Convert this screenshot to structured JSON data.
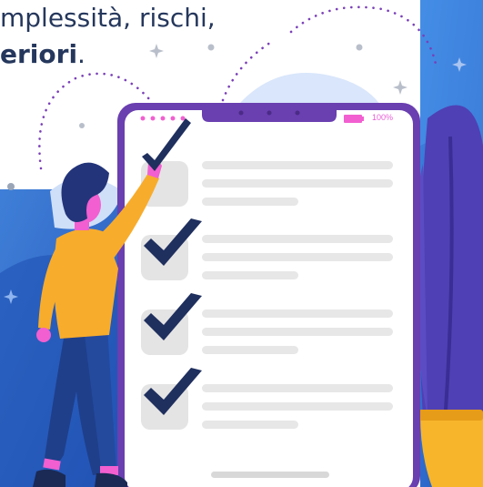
{
  "headline": {
    "line1": "mplessità, rischi,",
    "line2_bold": "eriori",
    "line2_end": "."
  },
  "phone": {
    "battery": "100%",
    "items": [
      {
        "checked": true
      },
      {
        "checked": true
      },
      {
        "checked": true
      },
      {
        "checked": true
      }
    ]
  },
  "colors": {
    "navy": "#25375c",
    "phone_frame": "#6a3fb0",
    "accent_pink": "#f25fd0",
    "shirt": "#f8ac2c",
    "blue_panel": "#2d6ad6"
  }
}
